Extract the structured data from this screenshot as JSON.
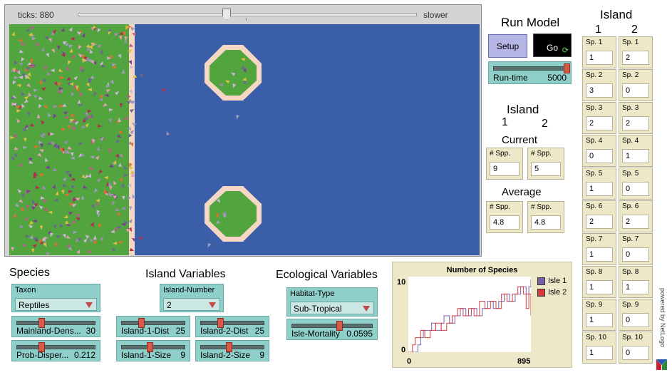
{
  "view": {
    "ticks_label": "ticks: 880",
    "speed_label": "slower",
    "mainland_color": "#52a43e",
    "beach_color": "#f6d7c3",
    "sea_color": "#3a5ea8"
  },
  "run_model": {
    "title": "Run Model",
    "setup_label": "Setup",
    "go_label": "Go",
    "runtime_label": "Run-time",
    "runtime_value": "5000"
  },
  "island_counts": {
    "title": "Island",
    "col1": "1",
    "col2": "2",
    "current_label": "Current",
    "average_label": "Average",
    "spp_label": "# Spp.",
    "current": [
      "9",
      "5"
    ],
    "average": [
      "4.8",
      "4.8"
    ]
  },
  "species_table": {
    "title": "Island",
    "col1": "1",
    "col2": "2",
    "rows": [
      {
        "label": "Sp. 1",
        "isle1": "1",
        "isle2": "2"
      },
      {
        "label": "Sp. 2",
        "isle1": "3",
        "isle2": "0"
      },
      {
        "label": "Sp. 3",
        "isle1": "2",
        "isle2": "2"
      },
      {
        "label": "Sp. 4",
        "isle1": "0",
        "isle2": "1"
      },
      {
        "label": "Sp. 5",
        "isle1": "1",
        "isle2": "0"
      },
      {
        "label": "Sp. 6",
        "isle1": "2",
        "isle2": "2"
      },
      {
        "label": "Sp. 7",
        "isle1": "1",
        "isle2": "0"
      },
      {
        "label": "Sp. 8",
        "isle1": "1",
        "isle2": "1"
      },
      {
        "label": "Sp. 9",
        "isle1": "1",
        "isle2": "0"
      },
      {
        "label": "Sp. 10",
        "isle1": "1",
        "isle2": "0"
      }
    ]
  },
  "species": {
    "title": "Species",
    "taxon_label": "Taxon",
    "taxon_value": "Reptiles",
    "mainland_density_label": "Mainland-Dens...",
    "mainland_density_value": "30",
    "mainland_density_level": 0.3,
    "prob_dispersal_label": "Prob-Disper...",
    "prob_dispersal_value": "0.212",
    "prob_dispersal_level": 0.3
  },
  "island_variables": {
    "title": "Island Variables",
    "number_label": "Island-Number",
    "number_value": "2",
    "island1_dist_label": "Island-1-Dist",
    "island1_dist_value": "25",
    "island1_dist_level": 0.3,
    "island2_dist_label": "Island-2-Dist",
    "island2_dist_value": "25",
    "island2_dist_level": 0.3,
    "island1_size_label": "Island-1-Size",
    "island1_size_value": "9",
    "island1_size_level": 0.45,
    "island2_size_label": "Island-2-Size",
    "island2_size_value": "9",
    "island2_size_level": 0.45
  },
  "ecological_variables": {
    "title": "Ecological Variables",
    "habitat_label": "Habitat-Type",
    "habitat_value": "Sub-Tropical",
    "mortality_label": "Isle-Mortality",
    "mortality_value": "0.0595",
    "mortality_level": 0.6
  },
  "plot": {
    "title": "Number of Species",
    "y_max_label": "10",
    "y_min_label": "0",
    "x_min_label": "0",
    "x_max_label": "895",
    "legend": [
      {
        "name": "Isle 1",
        "color": "#7b5ea8"
      },
      {
        "name": "Isle 2",
        "color": "#d63c3c"
      }
    ]
  },
  "branding": {
    "powered_by": "powered by NetLogo"
  },
  "chart_data": {
    "type": "line",
    "title": "Number of Species",
    "xlim": [
      0,
      895
    ],
    "ylim": [
      0,
      10
    ],
    "series": [
      {
        "name": "Isle 1",
        "x": [
          0,
          60,
          70,
          90,
          110,
          130,
          170,
          200,
          240,
          260,
          300,
          340,
          380,
          420,
          460,
          500,
          540,
          580,
          620,
          660,
          700,
          740,
          780,
          820,
          860,
          880,
          895
        ],
        "y": [
          0,
          0,
          1,
          2,
          3,
          3,
          4,
          3,
          4,
          5,
          4,
          5,
          6,
          5,
          6,
          5,
          6,
          7,
          6,
          7,
          8,
          7,
          8,
          9,
          8,
          9,
          10
        ]
      },
      {
        "name": "Isle 2",
        "x": [
          0,
          30,
          50,
          90,
          120,
          160,
          200,
          240,
          280,
          320,
          360,
          400,
          440,
          480,
          520,
          560,
          600,
          640,
          680,
          720,
          760,
          800,
          840,
          860,
          880,
          895
        ],
        "y": [
          0,
          1,
          2,
          3,
          2,
          3,
          4,
          3,
          4,
          5,
          6,
          5,
          6,
          5,
          7,
          6,
          7,
          6,
          8,
          7,
          8,
          9,
          8,
          6,
          8,
          5
        ]
      }
    ]
  }
}
